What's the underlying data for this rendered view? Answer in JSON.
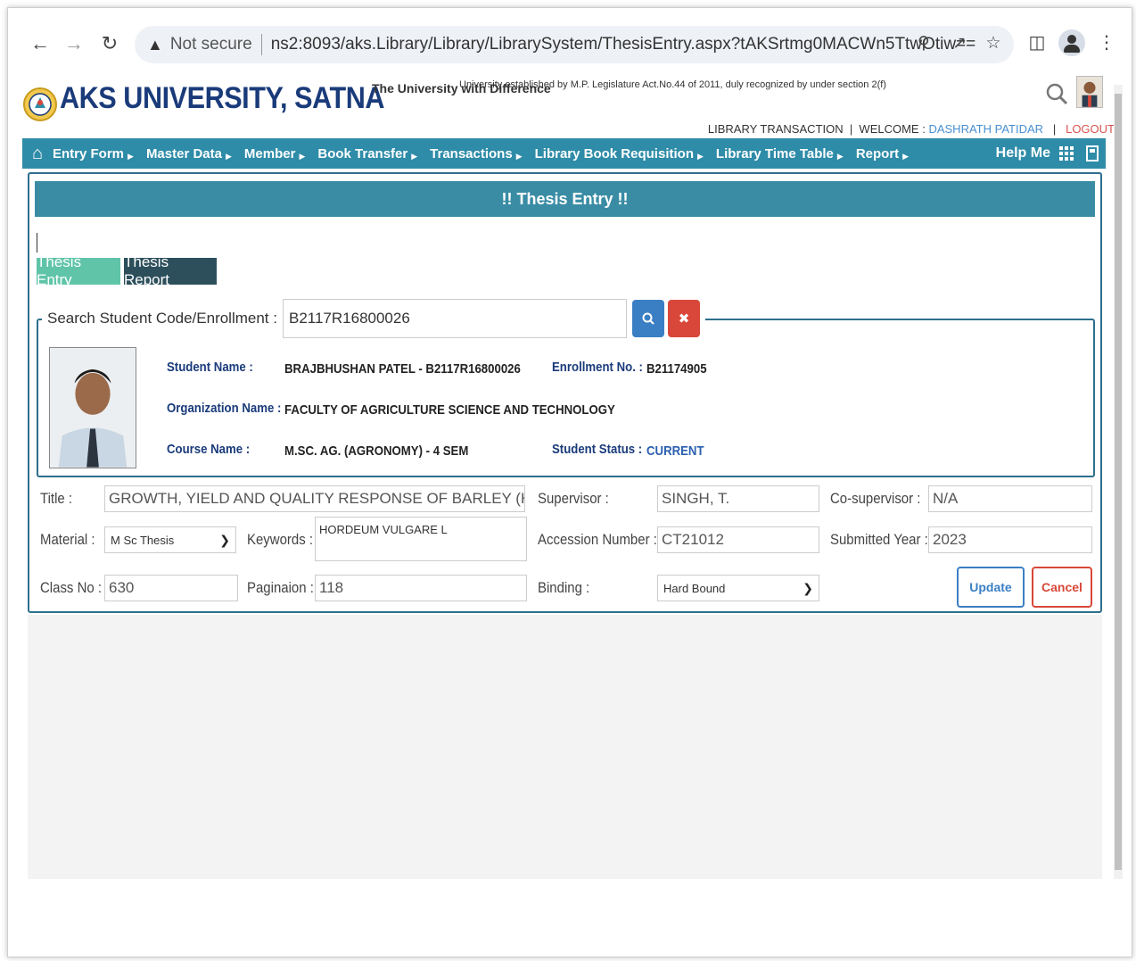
{
  "browser": {
    "security_label": "Not secure",
    "url": "ns2:8093/aks.Library/Library/LibrarySystem/ThesisEntry.aspx?tAKSrtmg0MACWn5TtwOtiw=="
  },
  "header": {
    "brand": "AKS UNIVERSITY, SATNA",
    "tagline": "The University with Difference",
    "established": "University established by M.P. Legislature Act.No.44 of 2011, duly recognized by under section 2(f)",
    "section": "LIBRARY TRANSACTION",
    "welcome_label": "WELCOME :",
    "user": "DASHRATH PATIDAR",
    "logout": "LOGOUT"
  },
  "menu": {
    "items": [
      "Entry Form",
      "Master Data",
      "Member",
      "Book Transfer",
      "Transactions",
      "Library Book Requisition",
      "Library Time Table",
      "Report"
    ],
    "help": "Help Me"
  },
  "page": {
    "title": "!! Thesis Entry !!",
    "tabs": [
      "Thesis Entry",
      "Thesis Report"
    ]
  },
  "search": {
    "label": "Search Student Code/Enrollment :",
    "value": "B2117R16800026"
  },
  "student": {
    "name_label": "Student Name :",
    "name": "BRAJBHUSHAN PATEL - B2117R16800026",
    "enrollment_label": "Enrollment No. :",
    "enrollment": "B21174905",
    "org_label": "Organization Name :",
    "org": "FACULTY OF AGRICULTURE SCIENCE AND TECHNOLOGY",
    "course_label": "Course Name :",
    "course": "M.SC. AG. (AGRONOMY) - 4 SEM",
    "status_label": "Student Status :",
    "status": "CURRENT"
  },
  "form": {
    "title_label": "Title :",
    "title": "GROWTH, YIELD AND QUALITY RESPONSE OF BARLEY (HORDEUM",
    "supervisor_label": "Supervisor :",
    "supervisor": "SINGH, T.",
    "cosupervisor_label": "Co-supervisor :",
    "cosupervisor": "N/A",
    "material_label": "Material :",
    "material": "M Sc Thesis",
    "keywords_label": "Keywords :",
    "keywords": "HORDEUM VULGARE L",
    "accession_label": "Accession Number :",
    "accession": "CT21012",
    "year_label": "Submitted Year :",
    "year": "2023",
    "classno_label": "Class No :",
    "classno": "630",
    "pagination_label": "Paginaion :",
    "pagination": "118",
    "binding_label": "Binding :",
    "binding": "Hard Bound",
    "update": "Update",
    "cancel": "Cancel"
  }
}
